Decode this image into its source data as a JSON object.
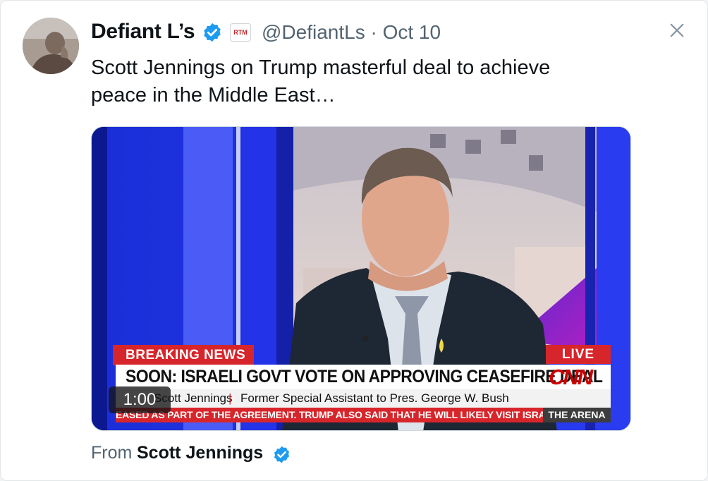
{
  "post": {
    "display_name": "Defiant L’s",
    "handle_line": "@DefiantLs · Oct 10",
    "affiliate_label": "RTM",
    "text_line1": "Scott Jennings on Trump masterful deal to achieve",
    "text_line2": "peace in the Middle East…",
    "close_icon": "close-icon",
    "verified_icon": "verified-badge-icon"
  },
  "video": {
    "breaking_label": "BREAKING NEWS",
    "live_label": "LIVE",
    "headline": "SOON: ISRAELI GOVT VOTE ON APPROVING CEASEFIRE DEAL",
    "network_logo": "CNN",
    "guest_name": "Scott Jennings",
    "separator": "|",
    "guest_title": "Former Special Assistant to Pres. George W. Bush",
    "ticker": "EASED AS PART OF THE AGREEMENT. TRUMP ALSO SAID THAT HE WILL LIKELY VISIT ISRA",
    "show_name": "THE ARENA",
    "duration": "1:00"
  },
  "attribution": {
    "prefix": "From",
    "name": "Scott Jennings"
  },
  "colors": {
    "verified_blue": "#1d9bf0",
    "cnn_red": "#cc0000",
    "breaking_red": "#d7262b",
    "text_primary": "#0f1419",
    "text_secondary": "#536471"
  }
}
